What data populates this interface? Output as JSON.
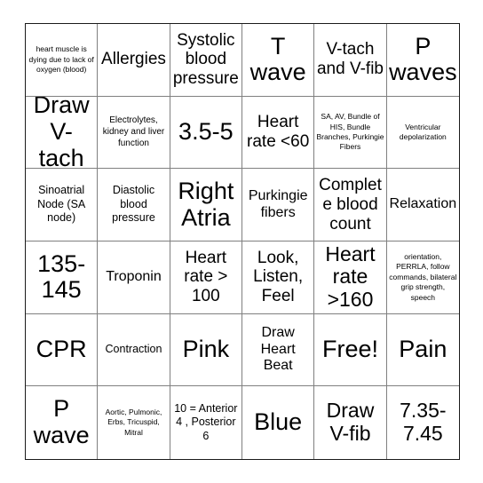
{
  "card": {
    "type": "bingo-card",
    "columns": 6,
    "rows": 6,
    "border_color": "#1a1a1a",
    "grid_line_color": "#808080",
    "background_color": "#ffffff",
    "text_color": "#000000",
    "cells": [
      {
        "text": "heart muscle is dying due to lack of oxygen (blood)",
        "size": "fs-xxs"
      },
      {
        "text": "Allergies",
        "size": "fs-l"
      },
      {
        "text": "Systolic blood pressure",
        "size": "fs-l"
      },
      {
        "text": "T wave",
        "size": "fs-xxl"
      },
      {
        "text": "V-tach and V-fib",
        "size": "fs-l"
      },
      {
        "text": "P waves",
        "size": "fs-xxl"
      },
      {
        "text": "Draw V-tach",
        "size": "fs-xxl"
      },
      {
        "text": "Electrolytes, kidney and liver function",
        "size": "fs-xs"
      },
      {
        "text": "3.5-5",
        "size": "fs-xxl"
      },
      {
        "text": "Heart rate <60",
        "size": "fs-l"
      },
      {
        "text": "SA, AV, Bundle of HIS, Bundle Branches, Purkingie Fibers",
        "size": "fs-xxs"
      },
      {
        "text": "Ventricular depolarization",
        "size": "fs-xxs"
      },
      {
        "text": "Sinoatrial Node (SA node)",
        "size": "fs-s"
      },
      {
        "text": "Diastolic blood pressure",
        "size": "fs-s"
      },
      {
        "text": "Right Atria",
        "size": "fs-xxl"
      },
      {
        "text": "Purkingie fibers",
        "size": "fs-m"
      },
      {
        "text": "Complete blood count",
        "size": "fs-l"
      },
      {
        "text": "Relaxation",
        "size": "fs-m"
      },
      {
        "text": "135-145",
        "size": "fs-xxl"
      },
      {
        "text": "Troponin",
        "size": "fs-m"
      },
      {
        "text": "Heart rate > 100",
        "size": "fs-l"
      },
      {
        "text": "Look, Listen, Feel",
        "size": "fs-l"
      },
      {
        "text": "Heart rate >160",
        "size": "fs-xl"
      },
      {
        "text": "orientation, PERRLA, follow commands, bilateral grip strength, speech",
        "size": "fs-xxs"
      },
      {
        "text": "CPR",
        "size": "fs-xxl"
      },
      {
        "text": "Contraction",
        "size": "fs-s"
      },
      {
        "text": "Pink",
        "size": "fs-xxl"
      },
      {
        "text": "Draw Heart Beat",
        "size": "fs-m"
      },
      {
        "text": "Free!",
        "size": "fs-xxl"
      },
      {
        "text": "Pain",
        "size": "fs-xxl"
      },
      {
        "text": "P wave",
        "size": "fs-xxl"
      },
      {
        "text": "Aortic, Pulmonic, Erbs, Tricuspid, Mitral",
        "size": "fs-xxs"
      },
      {
        "text": "10 = Anterior 4 , Posterior 6",
        "size": "fs-s"
      },
      {
        "text": "Blue",
        "size": "fs-xxl"
      },
      {
        "text": "Draw V-fib",
        "size": "fs-xl"
      },
      {
        "text": "7.35-7.45",
        "size": "fs-xl"
      }
    ]
  }
}
